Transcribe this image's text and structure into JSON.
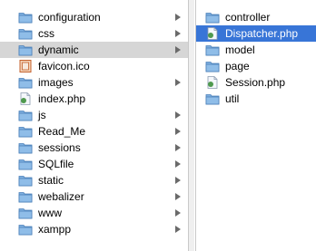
{
  "left_column": {
    "items": [
      {
        "label": "configuration",
        "icon": "folder-icon",
        "has_children": true,
        "selected": false
      },
      {
        "label": "css",
        "icon": "folder-icon",
        "has_children": true,
        "selected": false
      },
      {
        "label": "dynamic",
        "icon": "folder-icon",
        "has_children": true,
        "selected": true
      },
      {
        "label": "favicon.ico",
        "icon": "image-file-icon",
        "has_children": false,
        "selected": false
      },
      {
        "label": "images",
        "icon": "folder-icon",
        "has_children": true,
        "selected": false
      },
      {
        "label": "index.php",
        "icon": "php-file-icon",
        "has_children": false,
        "selected": false
      },
      {
        "label": "js",
        "icon": "folder-icon",
        "has_children": true,
        "selected": false
      },
      {
        "label": "Read_Me",
        "icon": "folder-icon",
        "has_children": true,
        "selected": false
      },
      {
        "label": "sessions",
        "icon": "folder-icon",
        "has_children": true,
        "selected": false
      },
      {
        "label": "SQLfile",
        "icon": "folder-icon",
        "has_children": true,
        "selected": false
      },
      {
        "label": "static",
        "icon": "folder-icon",
        "has_children": true,
        "selected": false
      },
      {
        "label": "webalizer",
        "icon": "folder-icon",
        "has_children": true,
        "selected": false
      },
      {
        "label": "www",
        "icon": "folder-icon",
        "has_children": true,
        "selected": false
      },
      {
        "label": "xampp",
        "icon": "folder-icon",
        "has_children": true,
        "selected": false
      }
    ]
  },
  "right_column": {
    "items": [
      {
        "label": "controller",
        "icon": "folder-icon",
        "selected": false
      },
      {
        "label": "Dispatcher.php",
        "icon": "php-file-icon",
        "selected": true
      },
      {
        "label": "model",
        "icon": "folder-icon",
        "selected": false
      },
      {
        "label": "page",
        "icon": "folder-icon",
        "selected": false
      },
      {
        "label": "Session.php",
        "icon": "php-file-icon",
        "selected": false
      },
      {
        "label": "util",
        "icon": "folder-icon",
        "selected": false
      }
    ]
  },
  "colors": {
    "selection_active": "#3875d7",
    "selection_inactive": "#d6d6d6",
    "folder": "#7fb0e0"
  }
}
